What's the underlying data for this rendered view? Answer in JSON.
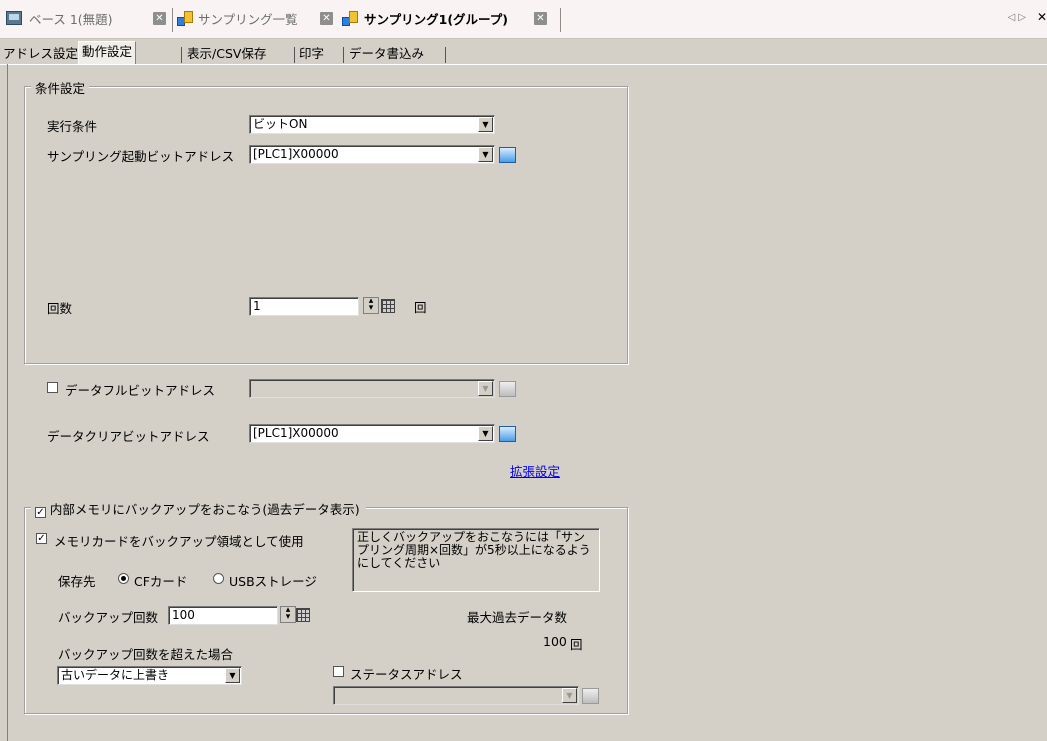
{
  "doc_tabs": [
    {
      "label": "ベース 1(無題)"
    },
    {
      "label": "サンプリング一覧"
    },
    {
      "label": "サンプリング1(グループ)"
    }
  ],
  "sub_tabs": [
    {
      "label": "アドレス設定"
    },
    {
      "label": "動作設定"
    },
    {
      "label": "表示/CSV保存"
    },
    {
      "label": "印字"
    },
    {
      "label": "データ書込み"
    }
  ],
  "condition_group": {
    "title": "条件設定",
    "exec_condition_label": "実行条件",
    "exec_condition_value": "ビットON",
    "start_bit_label": "サンプリング起動ビットアドレス",
    "start_bit_value": "[PLC1]X00000",
    "count_label": "回数",
    "count_value": "1",
    "count_unit": "回"
  },
  "data_full": {
    "label": "データフルビットアドレス",
    "checked": false,
    "value": ""
  },
  "data_clear": {
    "label": "データクリアビットアドレス",
    "value": "[PLC1]X00000"
  },
  "extended_link": "拡張設定",
  "backup_group": {
    "title": "内部メモリにバックアップをおこなう(過去データ表示)",
    "title_checked": true,
    "memcard_label": "メモリカードをバックアップ領域として使用",
    "memcard_checked": true,
    "save_to_label": "保存先",
    "radio_cf": "CFカード",
    "radio_usb": "USBストレージ",
    "selected": "CFカード",
    "note": "正しくバックアップをおこなうには「サンプリング周期×回数」が5秒以上になるようにしてください",
    "backup_count_label": "バックアップ回数",
    "backup_count_value": "100",
    "max_past_label": "最大過去データ数",
    "max_past_value": "100",
    "max_past_unit": "回",
    "overflow_label": "バックアップ回数を超えた場合",
    "overflow_value": "古いデータに上書き",
    "status_label": "ステータスアドレス",
    "status_checked": false,
    "status_value": ""
  }
}
